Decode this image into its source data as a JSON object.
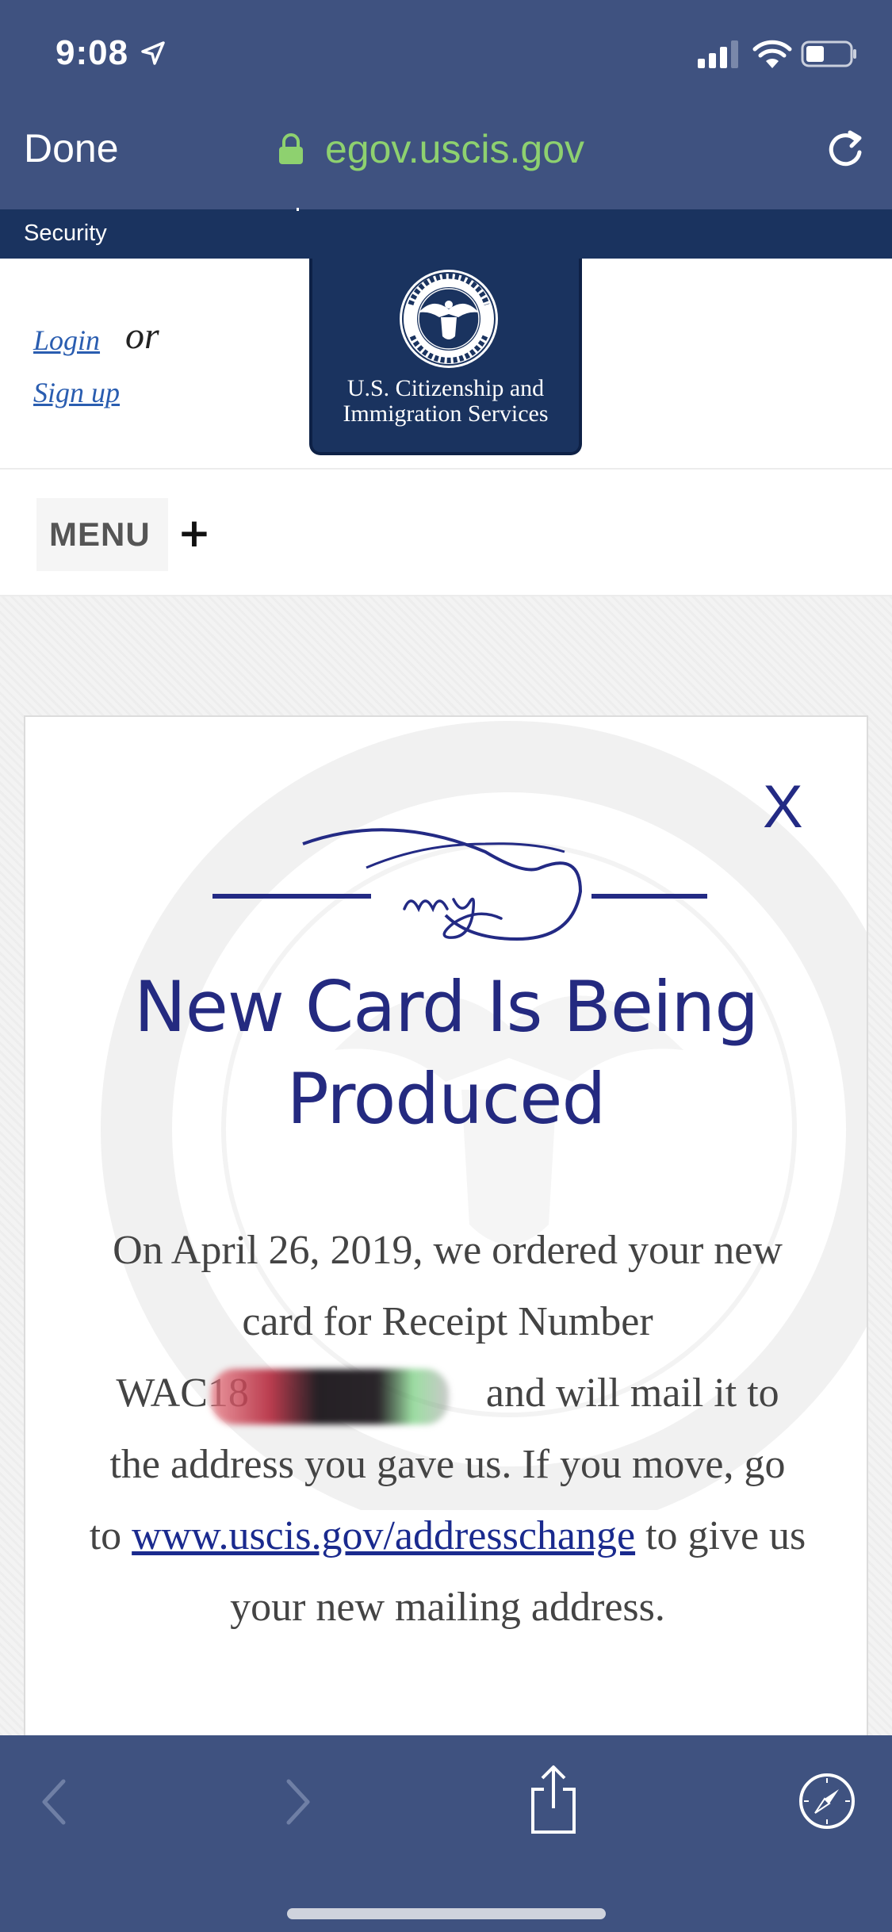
{
  "status_bar": {
    "time": "9:08"
  },
  "browser": {
    "done_label": "Done",
    "url": "egov.uscis.gov"
  },
  "site_header": {
    "strip_text": "Security",
    "login_label": "Login",
    "or_label": "or",
    "signup_label": "Sign up",
    "logo_line1": "U.S. Citizenship and",
    "logo_line2": "Immigration Services",
    "menu_label": "MENU",
    "menu_plus": "+"
  },
  "card": {
    "close_label": "X",
    "title_line1": "New Card Is Being",
    "title_line2": "Produced",
    "body_part1": "On April 26, 2019, we ordered your new card for Receipt Number ",
    "receipt_prefix": "WAC18",
    "body_part2": " and will mail it to the address you gave us. If you move, go to ",
    "link_text": "www.uscis.gov/addresschange",
    "body_part3": " to give us your new mailing address."
  },
  "colors": {
    "chrome": "#3f5280",
    "url_green": "#8ed16f",
    "gov_navy": "#1a335f",
    "title_blue": "#242a80",
    "link_blue": "#2a5db0"
  },
  "icons": {
    "location": "location-arrow-icon",
    "signal": "cellular-signal-icon",
    "wifi": "wifi-icon",
    "battery": "battery-icon",
    "lock": "lock-icon",
    "reload": "reload-icon",
    "seal": "dhs-seal-icon",
    "back": "chevron-left-icon",
    "forward": "chevron-right-icon",
    "share": "share-icon",
    "compass": "compass-icon"
  }
}
